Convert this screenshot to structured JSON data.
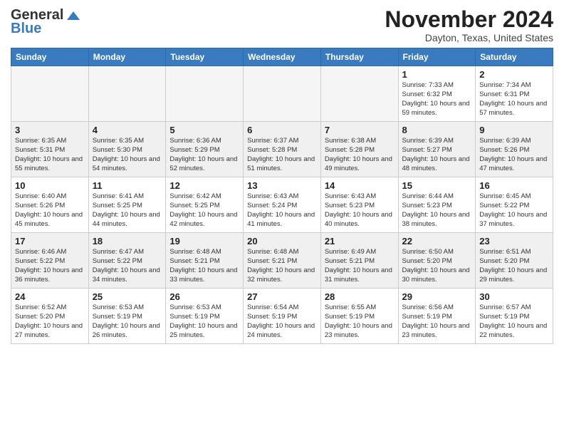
{
  "header": {
    "logo_general": "General",
    "logo_blue": "Blue",
    "month_title": "November 2024",
    "location": "Dayton, Texas, United States"
  },
  "days_of_week": [
    "Sunday",
    "Monday",
    "Tuesday",
    "Wednesday",
    "Thursday",
    "Friday",
    "Saturday"
  ],
  "weeks": [
    [
      {
        "day": "",
        "empty": true
      },
      {
        "day": "",
        "empty": true
      },
      {
        "day": "",
        "empty": true
      },
      {
        "day": "",
        "empty": true
      },
      {
        "day": "",
        "empty": true
      },
      {
        "day": "1",
        "sunrise": "Sunrise: 7:33 AM",
        "sunset": "Sunset: 6:32 PM",
        "daylight": "Daylight: 10 hours and 59 minutes."
      },
      {
        "day": "2",
        "sunrise": "Sunrise: 7:34 AM",
        "sunset": "Sunset: 6:31 PM",
        "daylight": "Daylight: 10 hours and 57 minutes."
      }
    ],
    [
      {
        "day": "3",
        "sunrise": "Sunrise: 6:35 AM",
        "sunset": "Sunset: 5:31 PM",
        "daylight": "Daylight: 10 hours and 55 minutes."
      },
      {
        "day": "4",
        "sunrise": "Sunrise: 6:35 AM",
        "sunset": "Sunset: 5:30 PM",
        "daylight": "Daylight: 10 hours and 54 minutes."
      },
      {
        "day": "5",
        "sunrise": "Sunrise: 6:36 AM",
        "sunset": "Sunset: 5:29 PM",
        "daylight": "Daylight: 10 hours and 52 minutes."
      },
      {
        "day": "6",
        "sunrise": "Sunrise: 6:37 AM",
        "sunset": "Sunset: 5:28 PM",
        "daylight": "Daylight: 10 hours and 51 minutes."
      },
      {
        "day": "7",
        "sunrise": "Sunrise: 6:38 AM",
        "sunset": "Sunset: 5:28 PM",
        "daylight": "Daylight: 10 hours and 49 minutes."
      },
      {
        "day": "8",
        "sunrise": "Sunrise: 6:39 AM",
        "sunset": "Sunset: 5:27 PM",
        "daylight": "Daylight: 10 hours and 48 minutes."
      },
      {
        "day": "9",
        "sunrise": "Sunrise: 6:39 AM",
        "sunset": "Sunset: 5:26 PM",
        "daylight": "Daylight: 10 hours and 47 minutes."
      }
    ],
    [
      {
        "day": "10",
        "sunrise": "Sunrise: 6:40 AM",
        "sunset": "Sunset: 5:26 PM",
        "daylight": "Daylight: 10 hours and 45 minutes."
      },
      {
        "day": "11",
        "sunrise": "Sunrise: 6:41 AM",
        "sunset": "Sunset: 5:25 PM",
        "daylight": "Daylight: 10 hours and 44 minutes."
      },
      {
        "day": "12",
        "sunrise": "Sunrise: 6:42 AM",
        "sunset": "Sunset: 5:25 PM",
        "daylight": "Daylight: 10 hours and 42 minutes."
      },
      {
        "day": "13",
        "sunrise": "Sunrise: 6:43 AM",
        "sunset": "Sunset: 5:24 PM",
        "daylight": "Daylight: 10 hours and 41 minutes."
      },
      {
        "day": "14",
        "sunrise": "Sunrise: 6:43 AM",
        "sunset": "Sunset: 5:23 PM",
        "daylight": "Daylight: 10 hours and 40 minutes."
      },
      {
        "day": "15",
        "sunrise": "Sunrise: 6:44 AM",
        "sunset": "Sunset: 5:23 PM",
        "daylight": "Daylight: 10 hours and 38 minutes."
      },
      {
        "day": "16",
        "sunrise": "Sunrise: 6:45 AM",
        "sunset": "Sunset: 5:22 PM",
        "daylight": "Daylight: 10 hours and 37 minutes."
      }
    ],
    [
      {
        "day": "17",
        "sunrise": "Sunrise: 6:46 AM",
        "sunset": "Sunset: 5:22 PM",
        "daylight": "Daylight: 10 hours and 36 minutes."
      },
      {
        "day": "18",
        "sunrise": "Sunrise: 6:47 AM",
        "sunset": "Sunset: 5:22 PM",
        "daylight": "Daylight: 10 hours and 34 minutes."
      },
      {
        "day": "19",
        "sunrise": "Sunrise: 6:48 AM",
        "sunset": "Sunset: 5:21 PM",
        "daylight": "Daylight: 10 hours and 33 minutes."
      },
      {
        "day": "20",
        "sunrise": "Sunrise: 6:48 AM",
        "sunset": "Sunset: 5:21 PM",
        "daylight": "Daylight: 10 hours and 32 minutes."
      },
      {
        "day": "21",
        "sunrise": "Sunrise: 6:49 AM",
        "sunset": "Sunset: 5:21 PM",
        "daylight": "Daylight: 10 hours and 31 minutes."
      },
      {
        "day": "22",
        "sunrise": "Sunrise: 6:50 AM",
        "sunset": "Sunset: 5:20 PM",
        "daylight": "Daylight: 10 hours and 30 minutes."
      },
      {
        "day": "23",
        "sunrise": "Sunrise: 6:51 AM",
        "sunset": "Sunset: 5:20 PM",
        "daylight": "Daylight: 10 hours and 29 minutes."
      }
    ],
    [
      {
        "day": "24",
        "sunrise": "Sunrise: 6:52 AM",
        "sunset": "Sunset: 5:20 PM",
        "daylight": "Daylight: 10 hours and 27 minutes."
      },
      {
        "day": "25",
        "sunrise": "Sunrise: 6:53 AM",
        "sunset": "Sunset: 5:19 PM",
        "daylight": "Daylight: 10 hours and 26 minutes."
      },
      {
        "day": "26",
        "sunrise": "Sunrise: 6:53 AM",
        "sunset": "Sunset: 5:19 PM",
        "daylight": "Daylight: 10 hours and 25 minutes."
      },
      {
        "day": "27",
        "sunrise": "Sunrise: 6:54 AM",
        "sunset": "Sunset: 5:19 PM",
        "daylight": "Daylight: 10 hours and 24 minutes."
      },
      {
        "day": "28",
        "sunrise": "Sunrise: 6:55 AM",
        "sunset": "Sunset: 5:19 PM",
        "daylight": "Daylight: 10 hours and 23 minutes."
      },
      {
        "day": "29",
        "sunrise": "Sunrise: 6:56 AM",
        "sunset": "Sunset: 5:19 PM",
        "daylight": "Daylight: 10 hours and 23 minutes."
      },
      {
        "day": "30",
        "sunrise": "Sunrise: 6:57 AM",
        "sunset": "Sunset: 5:19 PM",
        "daylight": "Daylight: 10 hours and 22 minutes."
      }
    ]
  ]
}
